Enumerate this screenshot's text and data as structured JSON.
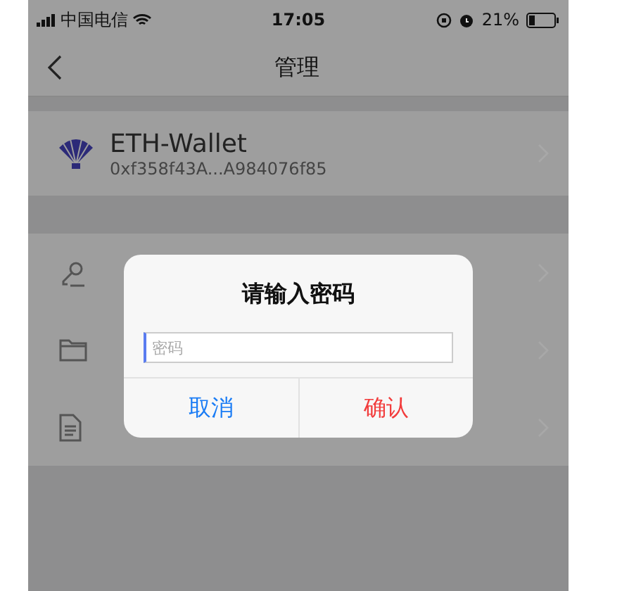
{
  "status_bar": {
    "carrier": "中国电信",
    "time": "17:05",
    "battery": "21%"
  },
  "nav": {
    "title": "管理"
  },
  "wallet": {
    "name": "ETH-Wallet",
    "address": "0xf358f43A...A984076f85"
  },
  "menu_items": [
    {
      "kind": "key"
    },
    {
      "kind": "folder"
    },
    {
      "kind": "document"
    }
  ],
  "dialog": {
    "title": "请输入密码",
    "password_field": {
      "placeholder": "密码"
    },
    "buttons": [
      {
        "label": "取消",
        "kind": "cancel"
      },
      {
        "label": "确认",
        "kind": "confirm"
      }
    ]
  }
}
